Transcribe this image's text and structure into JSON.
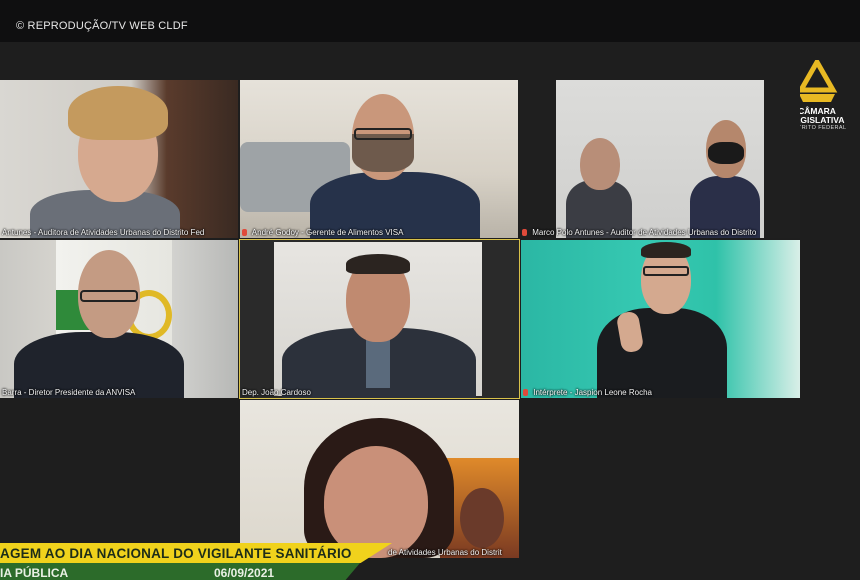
{
  "header": {
    "copyright": "© REPRODUÇÃO/TV WEB CLDF"
  },
  "logo": {
    "line1": "CÂMARA",
    "line2": "LEGISLATIVA",
    "line3": "DISTRITO FEDERAL",
    "color": "#e8b923"
  },
  "tiles": [
    {
      "name": "Antunes - Auditora de Atividades Urbanas do Distrito Fed",
      "muted": false
    },
    {
      "name": "André Godoy - Gerente de Alimentos VISA",
      "muted": true
    },
    {
      "name": "Marco Polo Antunes - Auditor de Atividades Urbanas do Distrito",
      "muted": true
    },
    {
      "name": "Barra - Diretor Presidente da ANVISA",
      "muted": false
    },
    {
      "name": "Dep. João Cardoso",
      "muted": false,
      "active": true
    },
    {
      "name": "Intérprete - Jaspion Leone Rocha",
      "muted": true
    },
    {
      "name": "de Atividades Urbanas do Distrit",
      "muted": false
    }
  ],
  "banner": {
    "title": "AGEM AO DIA NACIONAL DO VIGILANTE SANITÁRIO",
    "sub_left": "IA PÚBLICA",
    "sub_date": "06/09/2021"
  },
  "colors": {
    "banner_yellow": "#f0d21c",
    "banner_green": "#2c6b2a",
    "active_border": "#d9c24a",
    "mic_muted": "#e04a3a"
  }
}
